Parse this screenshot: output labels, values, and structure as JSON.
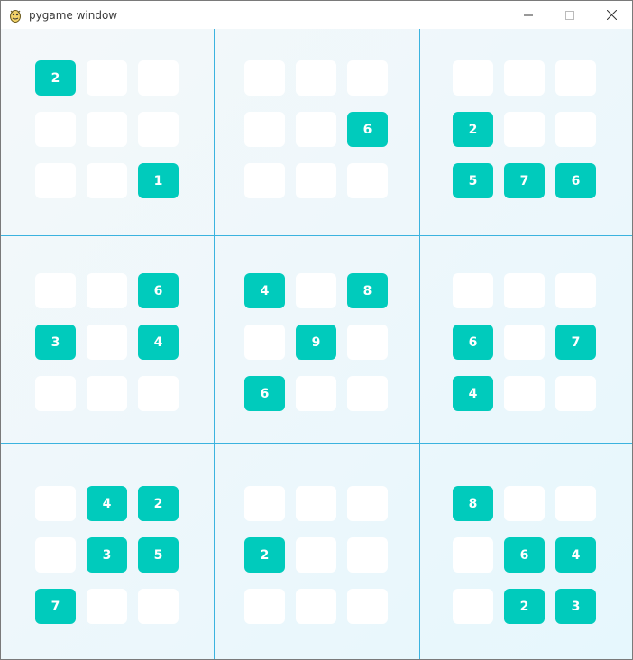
{
  "window": {
    "title": "pygame window",
    "controls": {
      "minimize_icon": "minimize-icon",
      "maximize_icon": "maximize-icon",
      "close_icon": "close-icon"
    }
  },
  "colors": {
    "filled_cell": "#00cbbc",
    "empty_cell": "#ffffff",
    "grid_line": "#3bb3df",
    "digit": "#ffffff"
  },
  "board": {
    "rows": [
      [
        "2",
        "",
        "",
        "",
        "",
        "",
        "",
        "",
        ""
      ],
      [
        "",
        "",
        "",
        "",
        "",
        "6",
        "2",
        "",
        ""
      ],
      [
        "",
        "",
        "1",
        "",
        "",
        "",
        "5",
        "7",
        "6"
      ],
      [
        "",
        "",
        "6",
        "4",
        "",
        "8",
        "",
        "",
        ""
      ],
      [
        "3",
        "",
        "4",
        "",
        "9",
        "",
        "6",
        "",
        "7"
      ],
      [
        "",
        "",
        "",
        "6",
        "",
        "",
        "4",
        "",
        ""
      ],
      [
        "",
        "4",
        "2",
        "",
        "",
        "",
        "8",
        "",
        ""
      ],
      [
        "",
        "3",
        "5",
        "2",
        "",
        "",
        "",
        "6",
        "4"
      ],
      [
        "7",
        "",
        "",
        "",
        "",
        "",
        "",
        "2",
        "3"
      ]
    ]
  }
}
